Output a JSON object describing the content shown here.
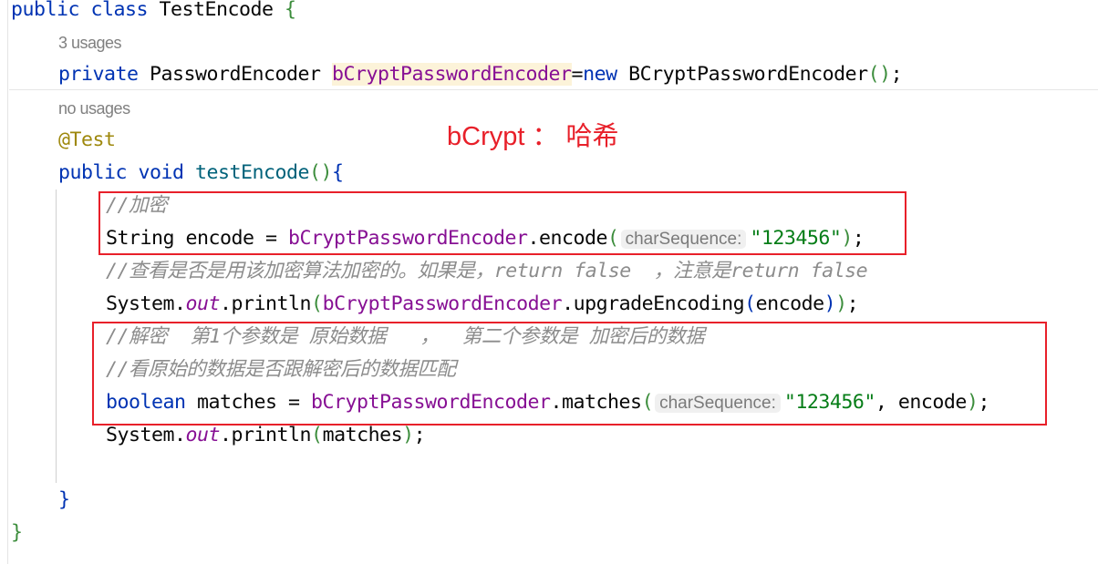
{
  "editor": {
    "lines": [
      {
        "indent": 0,
        "tokens": [
          {
            "t": "public class ",
            "c": "kw"
          },
          {
            "t": "TestEncode ",
            "c": "pl"
          },
          {
            "t": "{",
            "c": "p1"
          }
        ]
      },
      {
        "indent": 1,
        "hint": "3 usages"
      },
      {
        "indent": 1,
        "tokens": [
          {
            "t": "private ",
            "c": "kw"
          },
          {
            "t": "PasswordEncoder ",
            "c": "pl"
          },
          {
            "t": "bCryptPasswordEncoder",
            "c": "fld hl"
          },
          {
            "t": "=",
            "c": "pl"
          },
          {
            "t": "new ",
            "c": "kw"
          },
          {
            "t": "BCryptPasswordEncoder",
            "c": "pl"
          },
          {
            "t": "()",
            "c": "p1"
          },
          {
            "t": ";",
            "c": "pl"
          }
        ]
      },
      {
        "indent": 1,
        "hint": "no usages"
      },
      {
        "indent": 1,
        "tokens": [
          {
            "t": "@Test",
            "c": "ann"
          }
        ]
      },
      {
        "indent": 1,
        "tokens": [
          {
            "t": "public void ",
            "c": "kw"
          },
          {
            "t": "testEncode",
            "c": "mdecl"
          },
          {
            "t": "()",
            "c": "p1"
          },
          {
            "t": "{",
            "c": "p2"
          }
        ]
      },
      {
        "indent": 2,
        "tokens": [
          {
            "t": "//加密",
            "c": "cmt"
          }
        ]
      },
      {
        "indent": 2,
        "tokens": [
          {
            "t": "String encode = ",
            "c": "pl"
          },
          {
            "t": "bCryptPasswordEncoder",
            "c": "fld"
          },
          {
            "t": ".encode",
            "c": "pl"
          },
          {
            "t": "(",
            "c": "p1"
          },
          {
            "t": "charSequence:",
            "c": "inlay"
          },
          {
            "t": "\"123456\"",
            "c": "str"
          },
          {
            "t": ")",
            "c": "p1"
          },
          {
            "t": ";",
            "c": "pl"
          }
        ]
      },
      {
        "indent": 2,
        "tokens": [
          {
            "t": "//查看是否是用该加密算法加密的。如果是，return false  ，注意是return false",
            "c": "cmt"
          }
        ]
      },
      {
        "indent": 2,
        "tokens": [
          {
            "t": "System.",
            "c": "pl"
          },
          {
            "t": "out",
            "c": "sfld"
          },
          {
            "t": ".println",
            "c": "pl"
          },
          {
            "t": "(",
            "c": "p1"
          },
          {
            "t": "bCryptPasswordEncoder",
            "c": "fld"
          },
          {
            "t": ".upgradeEncoding",
            "c": "pl"
          },
          {
            "t": "(",
            "c": "p2"
          },
          {
            "t": "encode",
            "c": "pl"
          },
          {
            "t": ")",
            "c": "p2"
          },
          {
            "t": ")",
            "c": "p1"
          },
          {
            "t": ";",
            "c": "pl"
          }
        ]
      },
      {
        "indent": 2,
        "tokens": [
          {
            "t": "//解密  第1个参数是 原始数据   ，  第二个参数是 加密后的数据",
            "c": "cmt"
          }
        ]
      },
      {
        "indent": 2,
        "tokens": [
          {
            "t": "//看原始的数据是否跟解密后的数据匹配",
            "c": "cmt"
          }
        ]
      },
      {
        "indent": 2,
        "tokens": [
          {
            "t": "boolean ",
            "c": "kw"
          },
          {
            "t": "matches = ",
            "c": "pl"
          },
          {
            "t": "bCryptPasswordEncoder",
            "c": "fld"
          },
          {
            "t": ".matches",
            "c": "pl"
          },
          {
            "t": "(",
            "c": "p1"
          },
          {
            "t": "charSequence:",
            "c": "inlay"
          },
          {
            "t": "\"123456\"",
            "c": "str"
          },
          {
            "t": ", encode",
            "c": "pl"
          },
          {
            "t": ")",
            "c": "p1"
          },
          {
            "t": ";",
            "c": "pl"
          }
        ]
      },
      {
        "indent": 2,
        "tokens": [
          {
            "t": "System.",
            "c": "pl"
          },
          {
            "t": "out",
            "c": "sfld"
          },
          {
            "t": ".println",
            "c": "pl"
          },
          {
            "t": "(",
            "c": "p1"
          },
          {
            "t": "matches",
            "c": "pl"
          },
          {
            "t": ")",
            "c": "p1"
          },
          {
            "t": ";",
            "c": "pl"
          }
        ]
      },
      {
        "indent": 2,
        "tokens": []
      },
      {
        "indent": 1,
        "tokens": [
          {
            "t": "}",
            "c": "p2"
          }
        ]
      },
      {
        "indent": 0,
        "tokens": [
          {
            "t": "}",
            "c": "p1"
          }
        ]
      }
    ]
  },
  "annotation": {
    "text": "bCrypt ： 哈希",
    "color": "#E8202A"
  }
}
